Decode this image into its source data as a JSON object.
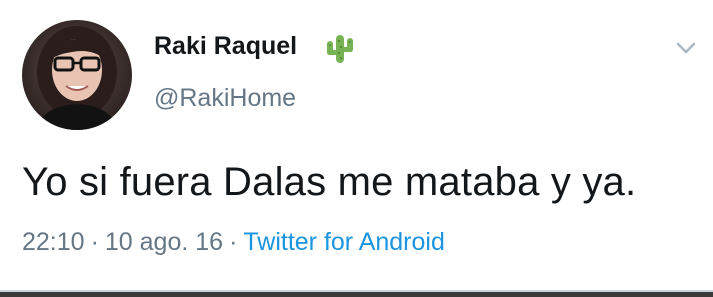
{
  "tweet": {
    "display_name": "Raki Raquel",
    "handle": "@RakiHome",
    "text": "Yo si fuera Dalas me mataba y ya.",
    "time": "22:10",
    "date": "10 ago. 16",
    "separator": "·",
    "source": "Twitter for Android"
  },
  "icons": {
    "name_emoji": "cactus-icon",
    "menu": "chevron-down-icon"
  },
  "colors": {
    "text": "#14171a",
    "secondary": "#657786",
    "link": "#1b95e0",
    "cactus": "#77b255"
  }
}
